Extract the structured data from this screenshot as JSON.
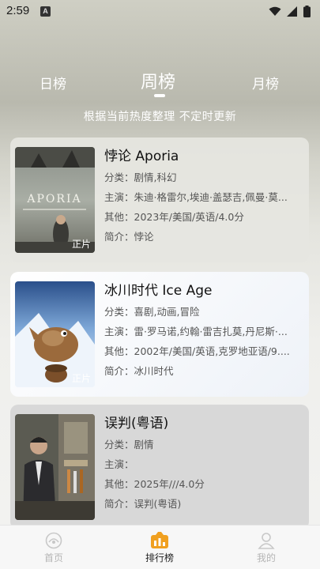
{
  "status_bar": {
    "time": "2:59",
    "badge": "A"
  },
  "tabs": {
    "day": "日榜",
    "week": "周榜",
    "month": "月榜",
    "active": "周榜"
  },
  "subtitle": "根据当前热度整理 不定时更新",
  "movies": [
    {
      "title": "悖论 Aporia",
      "genre": "分类：剧情,科幻",
      "cast": "主演：朱迪·格雷尔,埃迪·盖瑟吉,佩曼·莫...",
      "other": "其他：2023年/美国/英语/4.0分",
      "intro": "简介：悖论",
      "tag": "正片",
      "poster_word": "APORIA"
    },
    {
      "title": "冰川时代 Ice Age",
      "genre": "分类：喜剧,动画,冒险",
      "cast": "主演：雷·罗马诺,约翰·雷吉扎莫,丹尼斯·...",
      "other": "其他：2002年/美国/英语,克罗地亚语/9....",
      "intro": "简介：冰川时代",
      "tag": "正片"
    },
    {
      "title": "误判(粤语)",
      "genre": "分类：剧情",
      "cast": "主演：",
      "other": "其他：2025年///4.0分",
      "intro": "简介：误判(粤语)",
      "tag": ""
    }
  ],
  "nav": {
    "home": "首页",
    "rank": "排行榜",
    "mine": "我的",
    "active": "排行榜"
  },
  "colors": {
    "accent": "#f0a020",
    "inactive": "#b5b5b5"
  }
}
